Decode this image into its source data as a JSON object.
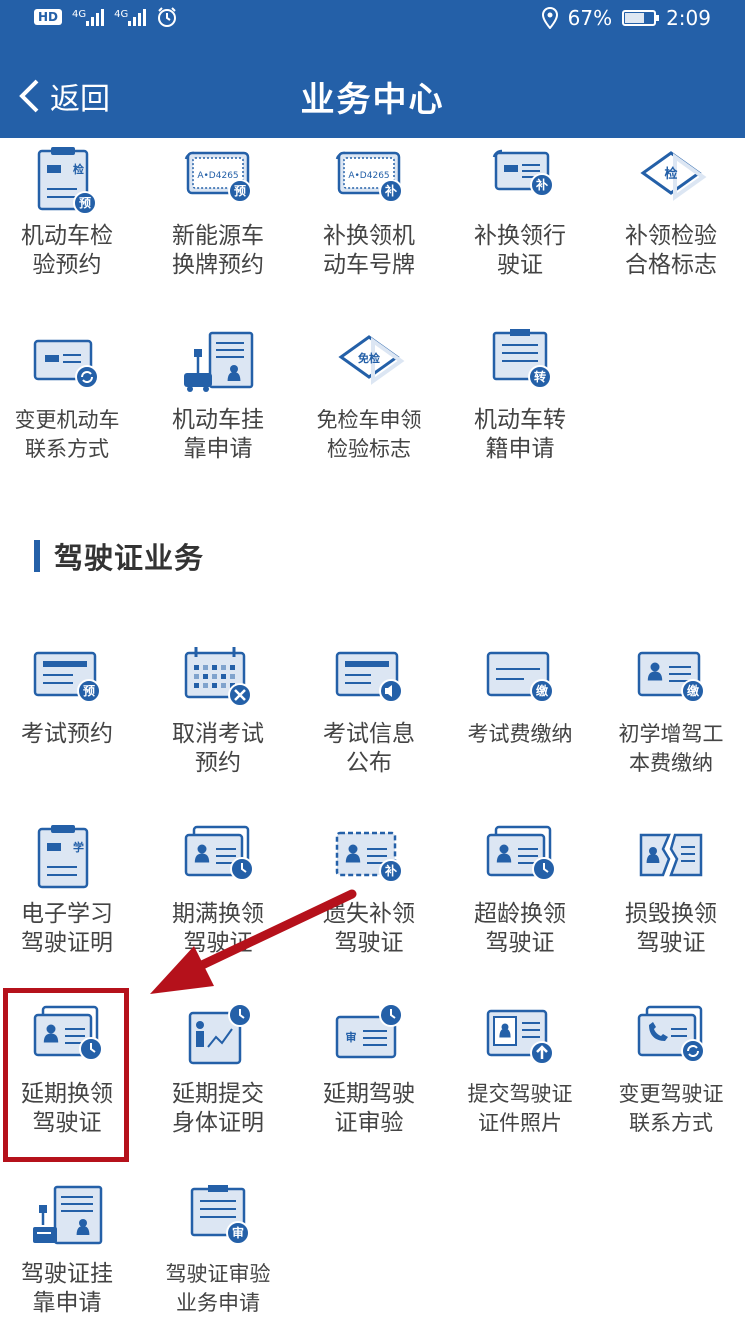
{
  "status_bar": {
    "hd": "HD",
    "sig1": "4G",
    "sig2": "4G",
    "battery_pct": "67%",
    "battery_level": 0.67,
    "time": "2:09"
  },
  "header": {
    "back_label": "返回",
    "title": "业务中心"
  },
  "vehicle_services": [
    {
      "label": "机动车检\n验预约",
      "icon": "inspection-clipboard-icon",
      "badge": "预"
    },
    {
      "label": "新能源车\n换牌预约",
      "icon": "license-plate-icon",
      "badge": "预",
      "plate": "A•D4265"
    },
    {
      "label": "补换领机\n动车号牌",
      "icon": "license-plate-icon",
      "badge": "补",
      "plate": "A•D4265"
    },
    {
      "label": "补换领行\n驶证",
      "icon": "driving-permit-icon",
      "badge": "补"
    },
    {
      "label": "补领检验\n合格标志",
      "icon": "diamond-badge-icon",
      "badge": "检"
    },
    {
      "label": "变更机动车\n联系方式",
      "icon": "car-card-sync-icon"
    },
    {
      "label": "机动车挂\n靠申请",
      "icon": "car-document-icon"
    },
    {
      "label": "免检车申领\n检验标志",
      "icon": "diamond-badge-icon",
      "badge": "免检"
    },
    {
      "label": "机动车转\n籍申请",
      "icon": "document-transfer-icon",
      "badge": "转"
    }
  ],
  "license_section_title": "驾驶证业务",
  "license_services": [
    {
      "label": "考试预约",
      "icon": "exam-card-icon",
      "badge": "预"
    },
    {
      "label": "取消考试\n预约",
      "icon": "calendar-cancel-icon"
    },
    {
      "label": "考试信息\n公布",
      "icon": "exam-announce-icon"
    },
    {
      "label": "考试费缴纳",
      "icon": "exam-fee-card-icon",
      "badge": "缴"
    },
    {
      "label": "初学增驾工\n本费缴纳",
      "icon": "person-card-fee-icon",
      "badge": "缴"
    },
    {
      "label": "电子学习\n驾驶证明",
      "icon": "study-clipboard-icon",
      "badge": "学"
    },
    {
      "label": "期满换领\n驾驶证",
      "icon": "person-card-clock-icon"
    },
    {
      "label": "遗失补领\n驾驶证",
      "icon": "lost-card-icon",
      "badge": "补"
    },
    {
      "label": "超龄换领\n驾驶证",
      "icon": "person-card-clock-icon"
    },
    {
      "label": "损毁换领\n驾驶证",
      "icon": "damaged-card-icon"
    },
    {
      "label": "延期换领\n驾驶证",
      "icon": "person-card-clock-icon"
    },
    {
      "label": "延期提交\n身体证明",
      "icon": "health-proof-icon"
    },
    {
      "label": "延期驾驶\n证审验",
      "icon": "audit-card-clock-icon",
      "badge": "审"
    },
    {
      "label": "提交驾驶证\n证件照片",
      "icon": "photo-upload-icon"
    },
    {
      "label": "变更驾驶证\n联系方式",
      "icon": "phone-card-sync-icon"
    },
    {
      "label": "驾驶证挂\n靠申请",
      "icon": "license-document-icon"
    },
    {
      "label": "驾驶证审验\n业务申请",
      "icon": "audit-document-icon",
      "badge": "审"
    }
  ],
  "colors": {
    "primary": "#2460a8",
    "icon_light": "#dce6f3",
    "highlight": "#b5111b",
    "text": "#444444"
  }
}
